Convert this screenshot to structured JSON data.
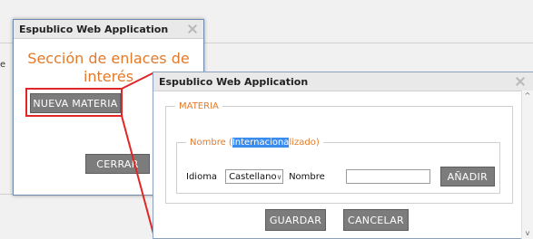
{
  "background": {
    "edge_text": "e"
  },
  "window1": {
    "title": "Espublico Web Application",
    "annotation_line1": "Sección de enlaces de",
    "annotation_line2": "interés",
    "nueva_materia_label": "NUEVA MATERIA",
    "cerrar_label": "CERRAR"
  },
  "window2": {
    "title": "Espublico Web Application",
    "materia_legend": "MATERIA",
    "nombre_legend_prefix": "Nombre (",
    "nombre_legend_selected": "Internaciona",
    "nombre_legend_suffix": "lizado)",
    "idioma_label": "Idioma",
    "idioma_value": "Castellano",
    "nombre_label": "Nombre",
    "nombre_input_value": "",
    "anadir_label": "AÑADIR",
    "guardar_label": "GUARDAR",
    "cancelar_label": "CANCELAR"
  },
  "colors": {
    "accent_orange": "#e27a2a",
    "highlight_red": "#e02626",
    "button_gray": "#7c7c7c",
    "selection_blue": "#3a8df0"
  }
}
